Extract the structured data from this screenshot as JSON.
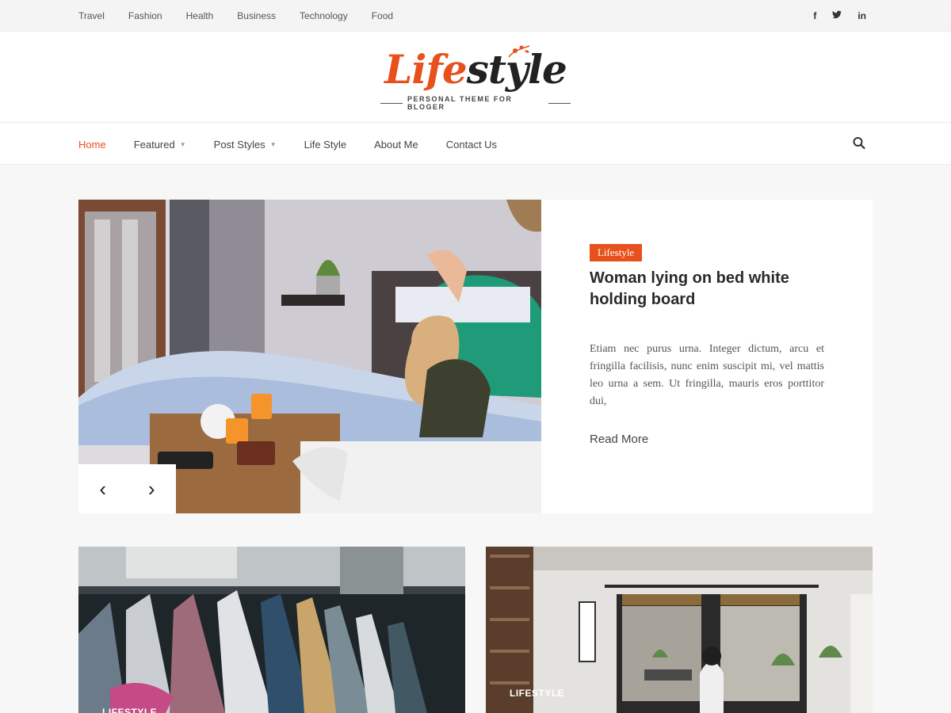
{
  "topbar": {
    "categories": [
      "Travel",
      "Fashion",
      "Health",
      "Business",
      "Technology",
      "Food"
    ],
    "social": {
      "facebook": "f",
      "twitter": "𝕥",
      "linkedin": "in"
    }
  },
  "logo": {
    "part1": "Life",
    "part2": "style",
    "tagline": "PERSONAL THEME FOR BLOGER",
    "accent_color": "#e8501c"
  },
  "nav": {
    "items": [
      {
        "label": "Home",
        "active": true
      },
      {
        "label": "Featured",
        "dropdown": true
      },
      {
        "label": "Post Styles",
        "dropdown": true
      },
      {
        "label": "Life Style"
      },
      {
        "label": "About Me"
      },
      {
        "label": "Contact Us"
      }
    ],
    "caret": "▼",
    "search_icon": "search-icon"
  },
  "hero": {
    "category": "Lifestyle",
    "title": "Woman lying on bed white holding board",
    "excerpt": "Etiam nec purus urna. Integer dictum, arcu et fringilla facilisis, nunc enim suscipit mi, vel mattis leo urna a sem. Ut fringilla, mauris eros porttitor dui,",
    "read_more": "Read More",
    "prev": "‹",
    "next": "›"
  },
  "cards": [
    {
      "category": "LIFESTYLE"
    },
    {
      "category": "LIFESTYLE"
    }
  ]
}
